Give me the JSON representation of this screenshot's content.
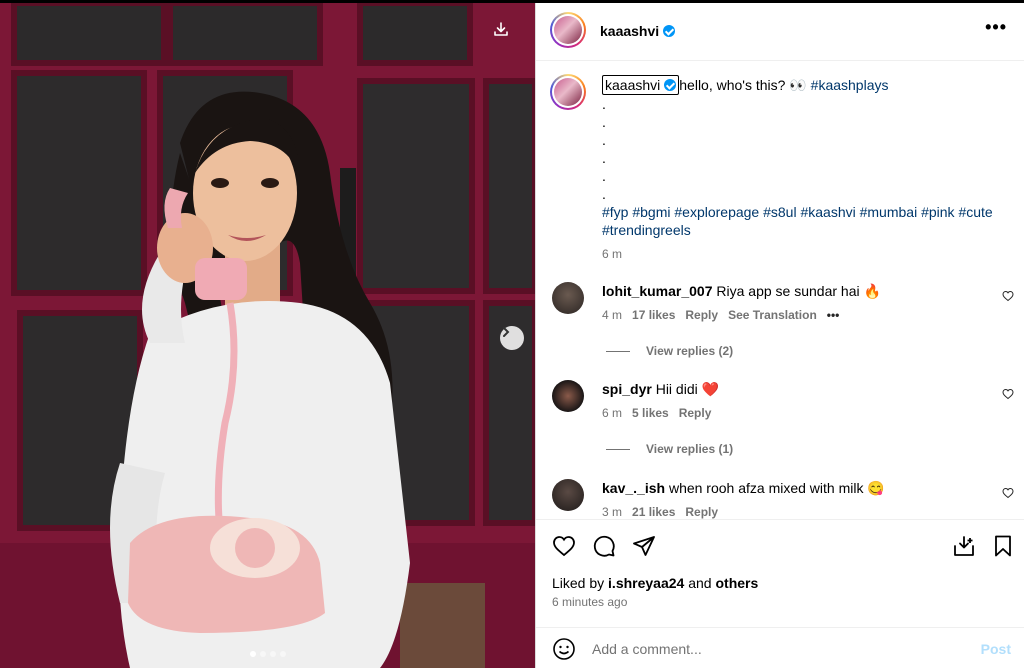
{
  "post": {
    "username": "kaaashvi",
    "more_label": "•••"
  },
  "caption": {
    "username": "kaaashvi",
    "text": "hello, who's this? 👀",
    "hashtag_main": "#kaashplays",
    "dots": [
      ".",
      ".",
      ".",
      ".",
      ".",
      "."
    ],
    "hashtags": "#fyp #bgmi #explorepage #s8ul #kaashvi #mumbai #pink #cute #trendingreels",
    "time": "6 m"
  },
  "comments": [
    {
      "username": "lohit_kumar_007",
      "text": "Riya app se sundar hai 🔥",
      "time": "4 m",
      "likes": "17 likes",
      "reply": "Reply",
      "translation": "See Translation",
      "more": "•••",
      "view_replies": "View replies (2)"
    },
    {
      "username": "spi_dyr",
      "text": "Hii didi ❤️",
      "time": "6 m",
      "likes": "5 likes",
      "reply": "Reply",
      "view_replies": "View replies (1)"
    },
    {
      "username": "kav_._ish",
      "text": "when rooh afza mixed with milk 😋",
      "time": "3 m",
      "likes": "21 likes",
      "reply": "Reply"
    }
  ],
  "likes": {
    "prefix": "Liked by",
    "user": "i.shreyaa24",
    "and": "and",
    "others": "others",
    "ago": "6 minutes ago"
  },
  "add_comment": {
    "placeholder": "Add a comment...",
    "post_label": "Post"
  },
  "carousel": {
    "total_slides": 4,
    "active_slide": 1
  },
  "colors": {
    "link": "#00376b",
    "muted": "#737373",
    "verified": "#0095f6",
    "post_disabled": "#b2dffc"
  }
}
